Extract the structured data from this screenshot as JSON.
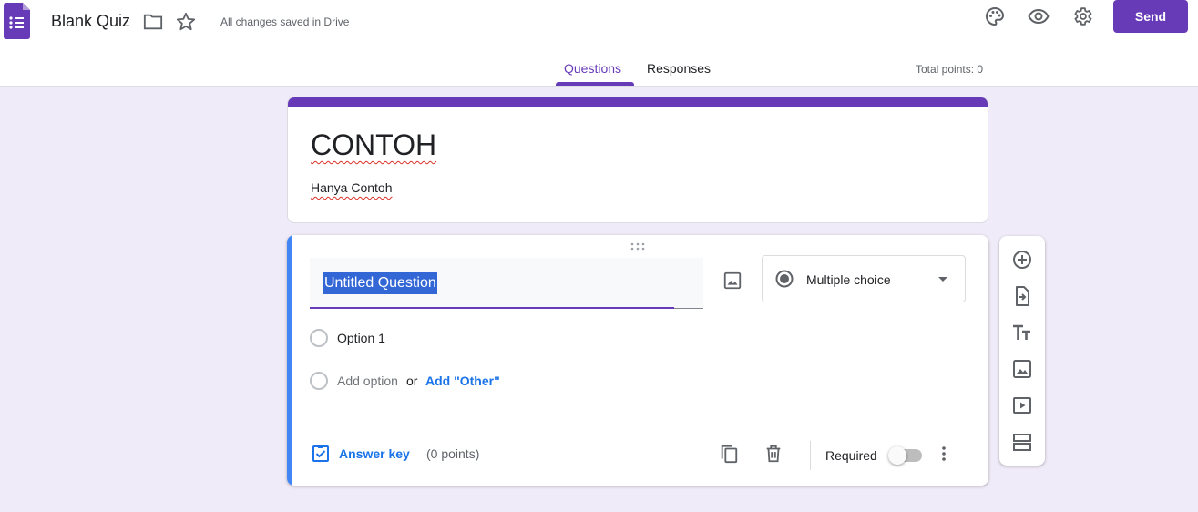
{
  "header": {
    "title": "Blank Quiz",
    "save_status": "All changes saved in Drive",
    "send_label": "Send",
    "icons": [
      "forms-logo-icon",
      "folder-icon",
      "star-icon",
      "palette-icon",
      "eye-icon",
      "gear-icon"
    ]
  },
  "tabs": [
    {
      "label": "Questions",
      "active": true
    },
    {
      "label": "Responses",
      "active": false
    }
  ],
  "total_points": "Total points: 0",
  "form": {
    "title": "CONTOH",
    "description": "Hanya Contoh"
  },
  "question": {
    "title": "Untitled Question",
    "type": "Multiple choice",
    "options": [
      "Option 1"
    ],
    "add_option": "Add option",
    "or": "or",
    "add_other": "Add \"Other\"",
    "answer_key": "Answer key",
    "points": "(0 points)",
    "required_label": "Required",
    "required": false
  },
  "toolbar": {
    "icons": [
      "add-question-icon",
      "import-questions-icon",
      "add-title-icon",
      "add-image-icon",
      "add-video-icon",
      "add-section-icon"
    ]
  },
  "colors": {
    "accent": "#673ab7",
    "background": "#f0ebf8",
    "link": "#1a73e8",
    "question_bar": "#4285f4",
    "selection": "#3367d6"
  }
}
